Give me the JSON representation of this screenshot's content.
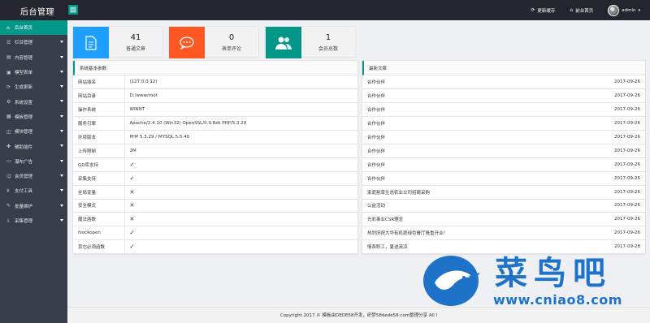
{
  "header": {
    "brand": "后台管理",
    "links": [
      {
        "label": "更新缓存",
        "icon": "refresh-icon"
      },
      {
        "label": "前台首页",
        "icon": "home-icon"
      }
    ],
    "user": "admin"
  },
  "sidebar": {
    "items": [
      {
        "label": "后台首页",
        "active": true
      },
      {
        "label": "栏目管理"
      },
      {
        "label": "内容管理"
      },
      {
        "label": "模型表单"
      },
      {
        "label": "生成更新"
      },
      {
        "label": "系统设置"
      },
      {
        "label": "模板管理"
      },
      {
        "label": "模块管理"
      },
      {
        "label": "辅助插件"
      },
      {
        "label": "瀑布广告"
      },
      {
        "label": "会员管理"
      },
      {
        "label": "支付工具"
      },
      {
        "label": "批量维护"
      },
      {
        "label": "采集管理"
      }
    ]
  },
  "stats": [
    {
      "value": "41",
      "label": "普通文章",
      "color": "#1e9fff"
    },
    {
      "value": "0",
      "label": "表单评论",
      "color": "#ff5722"
    },
    {
      "value": "1",
      "label": "会员总数",
      "color": "#009688"
    }
  ],
  "system": {
    "title": "系统基本参数",
    "rows": [
      {
        "key": "网站域名",
        "value": "(127.0.0.12)"
      },
      {
        "key": "网站目录",
        "value": "D:/www/root"
      },
      {
        "key": "操作系统",
        "value": "WINNT"
      },
      {
        "key": "服务引擎",
        "value": "Apache/2.4.10 (Win32) OpenSSL/0.9.8zb PHP/5.3.29"
      },
      {
        "key": "环境版本",
        "value": "PHP 5.3.29 / MYSQL 5.5.40"
      },
      {
        "key": "上传限制",
        "value": "2M"
      },
      {
        "key": "GD库支持",
        "value": "✓"
      },
      {
        "key": "采集支持",
        "value": "✓"
      },
      {
        "key": "全局变量",
        "value": "✕"
      },
      {
        "key": "安全模式",
        "value": "✕"
      },
      {
        "key": "魔法函数",
        "value": "✕"
      },
      {
        "key": "fsockopen",
        "value": "✓"
      },
      {
        "key": "其它必须函数",
        "value": "✓"
      }
    ]
  },
  "articles": {
    "title": "最新文章",
    "rows": [
      {
        "title": "合作伙伴",
        "date": "2017-09-26"
      },
      {
        "title": "合作伙伴",
        "date": "2017-09-26"
      },
      {
        "title": "合作伙伴",
        "date": "2017-09-26"
      },
      {
        "title": "合作伙伴",
        "date": "2017-09-26"
      },
      {
        "title": "合作伙伴",
        "date": "2017-09-26"
      },
      {
        "title": "合作伙伴",
        "date": "2017-09-26"
      },
      {
        "title": "合作伙伴",
        "date": "2017-09-26"
      },
      {
        "title": "合作伙伴",
        "date": "2017-09-26"
      },
      {
        "title": "家庭割草生态农业公司招聘采购",
        "date": "2017-09-26"
      },
      {
        "title": "公益活动",
        "date": "2017-09-26"
      },
      {
        "title": "光彩事业CSR理念",
        "date": "2017-09-26"
      },
      {
        "title": "热烈庆祝大华有机蔬绿色餐厅隆重开业！",
        "date": "2017-09-26"
      },
      {
        "title": "情系职工，夏送清凉",
        "date": "2017-09-28"
      }
    ]
  },
  "footer": "Copyright 2017 © 模板由DEDE58开发，织梦58dede58.com整理分享 All I",
  "watermark": {
    "text": "菜鸟吧",
    "url": "www.cniao8.com"
  }
}
